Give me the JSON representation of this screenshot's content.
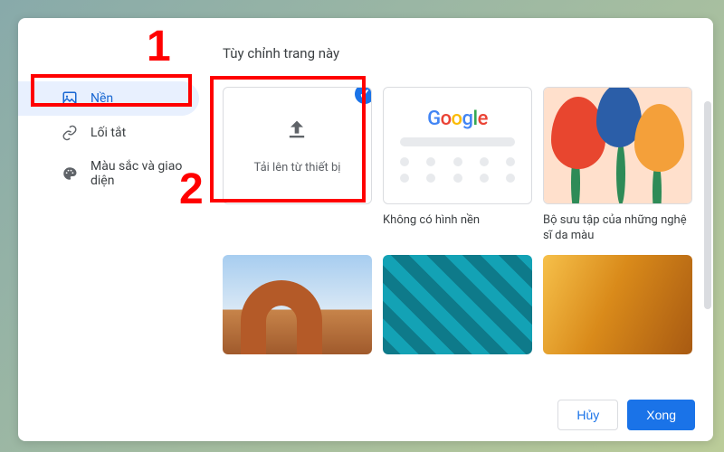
{
  "dialog": {
    "title": "Tùy chỉnh trang này"
  },
  "sidebar": {
    "items": [
      {
        "label": "Nền",
        "icon": "image-frame-icon",
        "active": true
      },
      {
        "label": "Lối tắt",
        "icon": "link-icon",
        "active": false
      },
      {
        "label": "Màu sắc và giao diện",
        "icon": "palette-icon",
        "active": false
      }
    ]
  },
  "tiles": {
    "upload": {
      "label": "Tải lên từ thiết bị",
      "selected": true
    },
    "none": {
      "caption": "Không có hình nền"
    },
    "artists": {
      "caption": "Bộ sưu tập của những nghệ sĩ da màu"
    }
  },
  "footer": {
    "cancel": "Hủy",
    "done": "Xong"
  },
  "annotations": {
    "one": "1",
    "two": "2"
  }
}
